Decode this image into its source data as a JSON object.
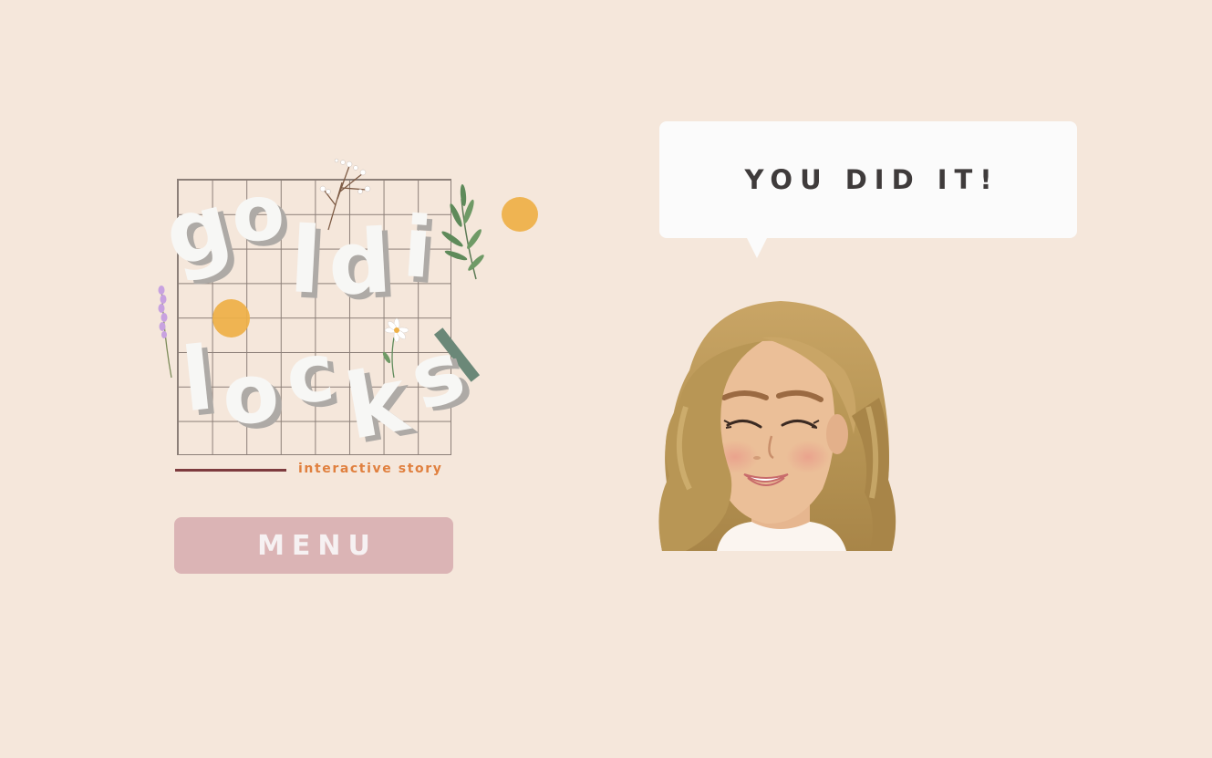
{
  "logo": {
    "letters_top": [
      "g",
      "o",
      "l",
      "d",
      "i"
    ],
    "letters_bottom": [
      "l",
      "o",
      "c",
      "k",
      "s"
    ],
    "tagline": "interactive story"
  },
  "menu_button": {
    "label": "MENU"
  },
  "speech_bubble": {
    "text": "YOU DID IT!"
  },
  "character": {
    "name": "goldilocks-avatar",
    "expression": "happy"
  },
  "colors": {
    "background": "#f5e7db",
    "menu_button": "#dbb4b5",
    "bubble": "#fbfbfb",
    "bubble_text": "#3f3b3b",
    "tagline": "#e0803f",
    "accent_dot": "#eeb047"
  }
}
